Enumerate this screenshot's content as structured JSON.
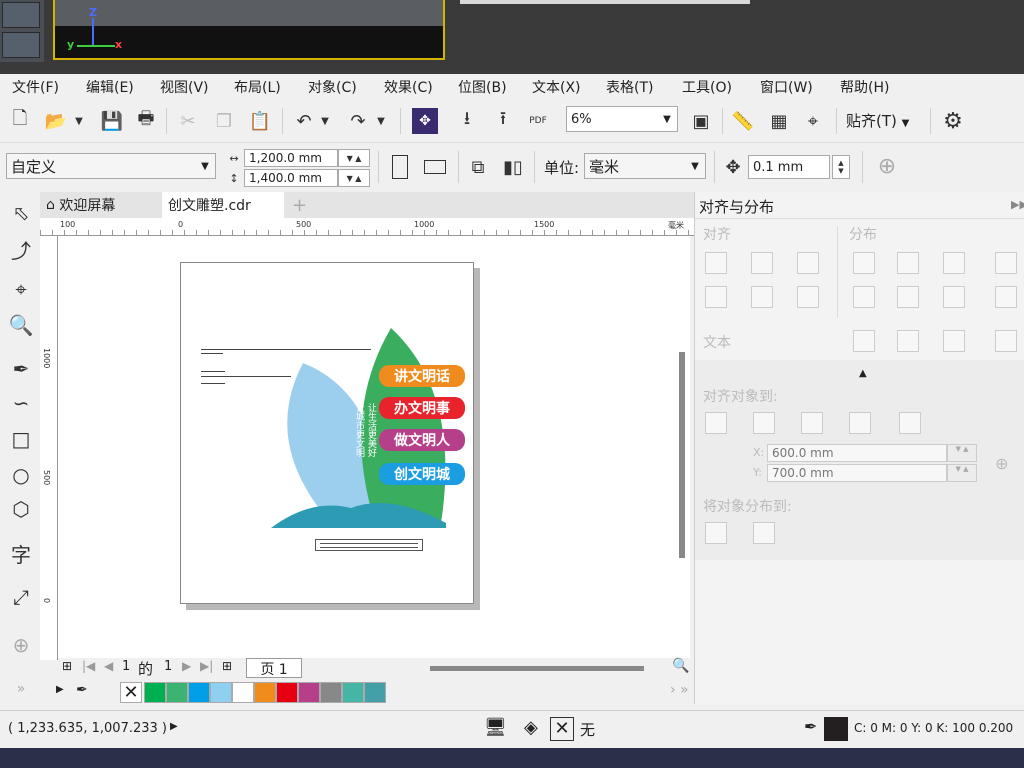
{
  "menu": [
    "文件(F)",
    "编辑(E)",
    "视图(V)",
    "布局(L)",
    "对象(C)",
    "效果(C)",
    "位图(B)",
    "文本(X)",
    "表格(T)",
    "工具(O)",
    "窗口(W)",
    "帮助(H)"
  ],
  "viewport_axes": {
    "z": "Z",
    "y": "y",
    "x": "x"
  },
  "toolbar1": {
    "zoom": "6%",
    "pdf": "PDF",
    "snap_label": "贴齐(T)"
  },
  "toolbar2": {
    "preset": "自定义",
    "width": "1,200.0 mm",
    "height": "1,400.0 mm",
    "unit_label": "单位:",
    "unit_value": "毫米",
    "nudge": "0.1 mm"
  },
  "tabs": {
    "welcome": "欢迎屏幕",
    "doc": "创文雕塑.cdr",
    "add": "+"
  },
  "ruler": {
    "h_labels": [
      "100",
      "0",
      "500",
      "1000",
      "1500",
      "毫米"
    ],
    "v_labels": [
      "1000",
      "500",
      "0"
    ]
  },
  "pagebar": {
    "current": "1",
    "of": "的",
    "total": "1",
    "page_tab": "页 1"
  },
  "artwork": {
    "left_title": "创建文明城市",
    "left_sub": "Create a civilized city",
    "right_side": [
      "让生活更美好",
      "让城市更文明"
    ],
    "pills": [
      "讲文明话",
      "办文明事",
      "做文明人",
      "创文明城"
    ],
    "pill_colors": [
      "#f08c1e",
      "#e8232b",
      "#b63f8a",
      "#1b9de2"
    ]
  },
  "palette": [
    "#00b050",
    "#3cb371",
    "#009fe8",
    "#8fd0f0",
    "#ffffff",
    "#f08c1e",
    "#e60012",
    "#b63f8a",
    "#888888",
    "#45b5a5",
    "#43a0a8"
  ],
  "status": {
    "coords": "( 1,233.635, 1,007.233 )",
    "fill_none": "无",
    "color_info": "C: 0 M: 0 Y: 0 K: 100  0.200"
  },
  "dock": {
    "title": "对齐与分布",
    "align": "对齐",
    "distribute": "分布",
    "text": "文本",
    "align_to": "对齐对象到:",
    "x_label": "X:",
    "x_value": "600.0 mm",
    "y_label": "Y:",
    "y_value": "700.0 mm",
    "distribute_to": "将对象分布到:"
  }
}
